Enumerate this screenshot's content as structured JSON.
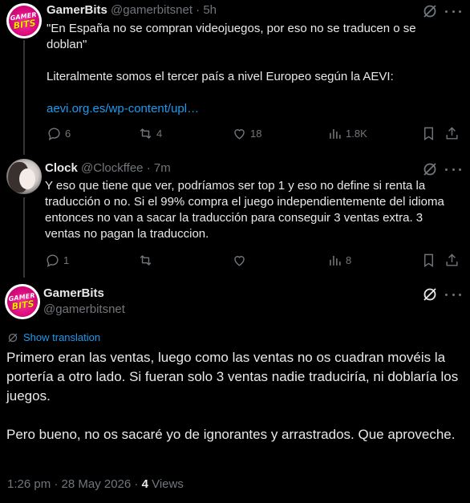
{
  "reply1": {
    "name": "GamerBits",
    "handle": "@gamerbitsnet",
    "time": "5h",
    "text": "\"En España no se compran videojuegos, por eso no se traducen o se doblan\"\n\nLiteralmente somos el tercer país a nivel Europeo según la AEVI:\n\n",
    "link": "aevi.org.es/wp-content/upl…",
    "stats": {
      "replies": "6",
      "reposts": "4",
      "likes": "18",
      "views": "1.8K"
    }
  },
  "reply2": {
    "name": "Clock",
    "handle": "@Clockffee",
    "time": "7m",
    "text": "Y eso que tiene que ver, podríamos ser top 1 y eso no define si renta la traducción o no. Si el 99% compra el juego independientemente del idioma entonces no van a sacar la traducción para conseguir 3 ventas extra. 3 ventas no pagan la traduccion.",
    "stats": {
      "replies": "1",
      "reposts": "",
      "likes": "",
      "views": "8"
    }
  },
  "main": {
    "name": "GamerBits",
    "handle": "@gamerbitsnet",
    "show_translation": "Show translation",
    "text": "Primero eran las ventas, luego como las ventas no os cuadran movéis la portería a otro lado. Si fueran solo 3 ventas nadie traduciría, ni doblaría los juegos.\n\nPero bueno, no os sacaré yo de ignorantes y arrastrados. Que aproveche.",
    "time": "1:26 pm · 28 May 2026 · ",
    "views_count": "4",
    "views_label": " Views"
  },
  "logo": {
    "line1": "GAMER",
    "line2": "BITS"
  },
  "colors": {
    "link": "#1d9bf0",
    "muted": "#71767b",
    "text": "#e7e9ea",
    "background": "#000000"
  },
  "icons": [
    "grok-icon",
    "more-icon",
    "reply-icon",
    "repost-icon",
    "like-icon",
    "views-icon",
    "bookmark-icon",
    "share-icon",
    "translate-icon"
  ]
}
